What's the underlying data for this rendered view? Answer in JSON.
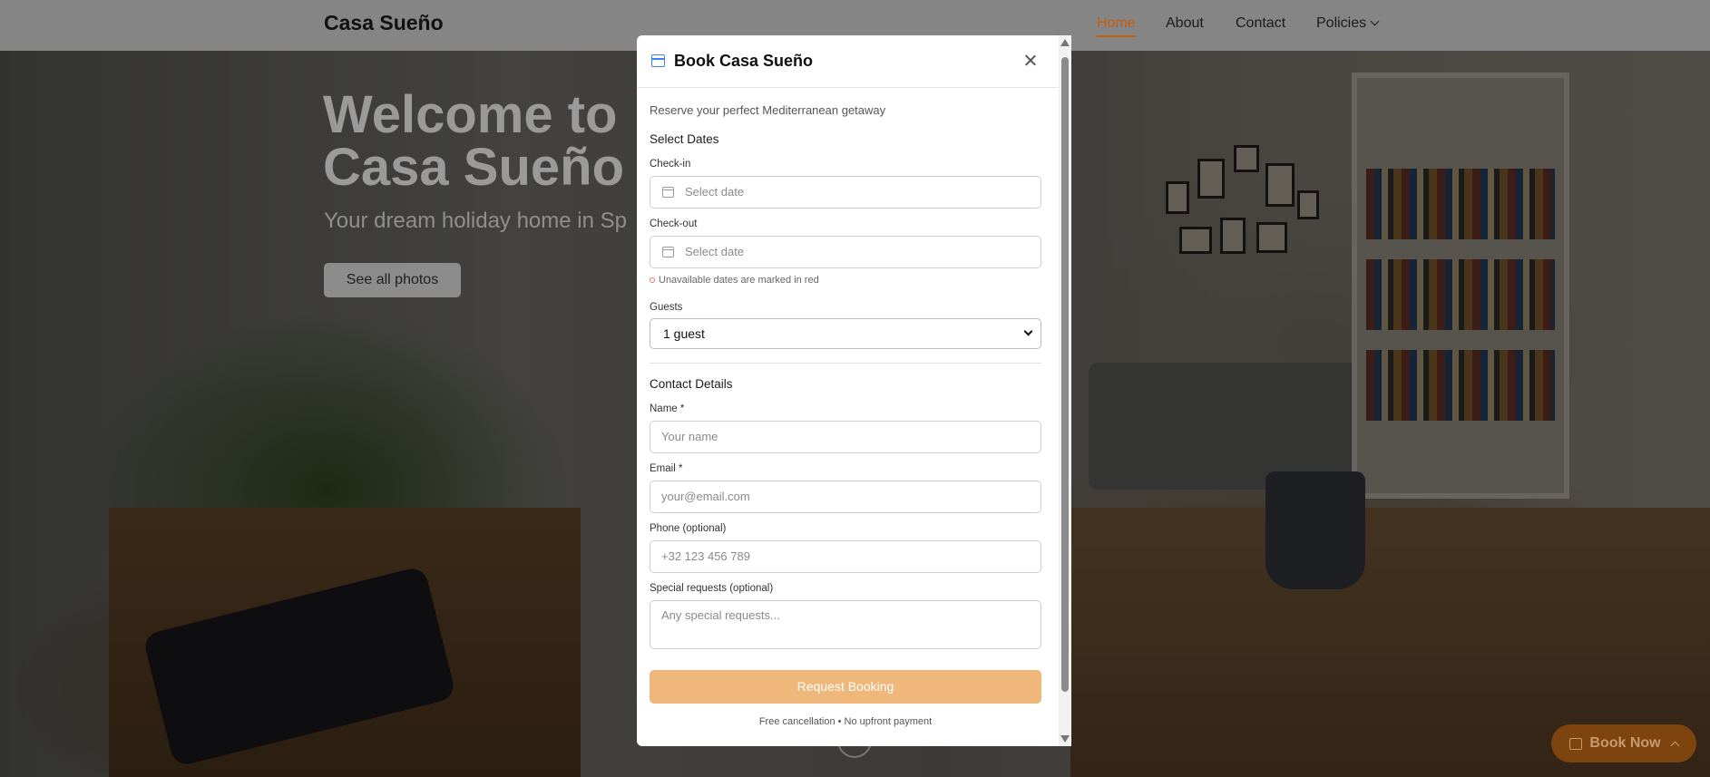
{
  "nav": {
    "brand": "Casa Sueño",
    "links": [
      "Home",
      "About",
      "Contact",
      "Policies"
    ]
  },
  "hero": {
    "title_line1": "Welcome to",
    "title_line2": "Casa Sueño",
    "subtitle": "Your dream holiday home in Sp",
    "photos_button": "See all photos"
  },
  "floating": {
    "book_now": "Book Now"
  },
  "modal": {
    "title": "Book Casa Sueño",
    "intro": "Reserve your perfect Mediterranean getaway",
    "dates_section": "Select Dates",
    "checkin_label": "Check-in",
    "checkin_placeholder": "Select date",
    "checkout_label": "Check-out",
    "checkout_placeholder": "Select date",
    "unavailable_note": "Unavailable dates are marked in red",
    "guests_label": "Guests",
    "guests_value": "1 guest",
    "contact_section": "Contact Details",
    "name_label": "Name *",
    "name_placeholder": "Your name",
    "email_label": "Email *",
    "email_placeholder": "your@email.com",
    "phone_label": "Phone (optional)",
    "phone_placeholder": "+32 123 456 789",
    "requests_label": "Special requests (optional)",
    "requests_placeholder": "Any special requests...",
    "submit": "Request Booking",
    "footnote": "Free cancellation • No upfront payment"
  },
  "colors": {
    "accent": "#c45c0e",
    "submit_bg": "#efb77a",
    "icon_blue": "#3b82f6",
    "book_now_bg": "#7d4410"
  }
}
